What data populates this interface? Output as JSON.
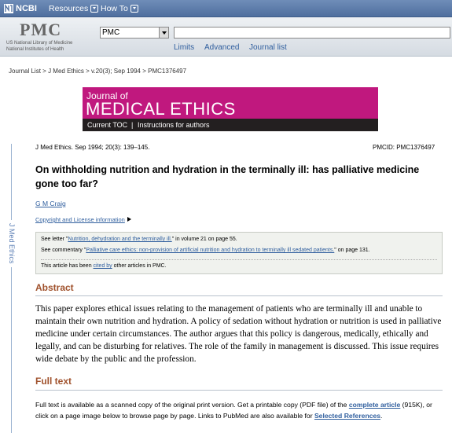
{
  "ncbi": {
    "logo": "NCBI",
    "menus": [
      "Resources",
      "How To"
    ]
  },
  "pmc": {
    "logo": "PMC",
    "org_line1": "US National Library of Medicine",
    "org_line2": "National Institutes of Health",
    "db_selected": "PMC",
    "search_value": "",
    "links": [
      "Limits",
      "Advanced",
      "Journal list"
    ]
  },
  "breadcrumb": [
    "Journal List",
    "J Med Ethics",
    "v.20(3); Sep 1994",
    "PMC1376497"
  ],
  "banner": {
    "journal_of": "Journal of",
    "title": "MEDICAL ETHICS",
    "current_toc": "Current TOC",
    "instructions": "Instructions for authors"
  },
  "side_tab": "J Med Ethics",
  "article": {
    "citation": "J Med Ethics. Sep 1994; 20(3): 139–145.",
    "pmcid": "PMCID: PMC1376497",
    "title": "On withholding nutrition and hydration in the terminally ill: has palliative medicine gone too far?",
    "author": "G M Craig",
    "copyright": "Copyright and License information"
  },
  "notes": {
    "see_letter_pre": "See letter \"",
    "see_letter_link": "Nutrition, dehydration and the terminally ill.",
    "see_letter_post": "\" in volume 21 on page 55.",
    "see_comm_pre": "See commentary \"",
    "see_comm_link": "Palliative care ethics: non-provision of artificial nutrition and hydration to terminally ill sedated patients.",
    "see_comm_post": "\" on page 131.",
    "cited_pre": "This article has been ",
    "cited_link": "cited by",
    "cited_post": " other articles in PMC."
  },
  "abstract": {
    "heading": "Abstract",
    "text": "This paper explores ethical issues relating to the management of patients who are terminally ill and unable to maintain their own nutrition and hydration. A policy of sedation without hydration or nutrition is used in palliative medicine under certain circumstances. The author argues that this policy is dangerous, medically, ethically and legally, and can be disturbing for relatives. The role of the family in management is discussed. This issue requires wide debate by the public and the profession."
  },
  "fulltext": {
    "heading": "Full text",
    "pre": "Full text is available as a scanned copy of the original print version. Get a printable copy (PDF file) of the ",
    "complete_article": "complete article",
    "mid": " (915K), or click on a page image below to browse page by page. Links to PubMed are also available for ",
    "selected_refs": "Selected References",
    "post": "."
  },
  "colors": {
    "banner": "#c0187e",
    "section_heading": "#a0522d",
    "link": "#2f5e9e"
  }
}
